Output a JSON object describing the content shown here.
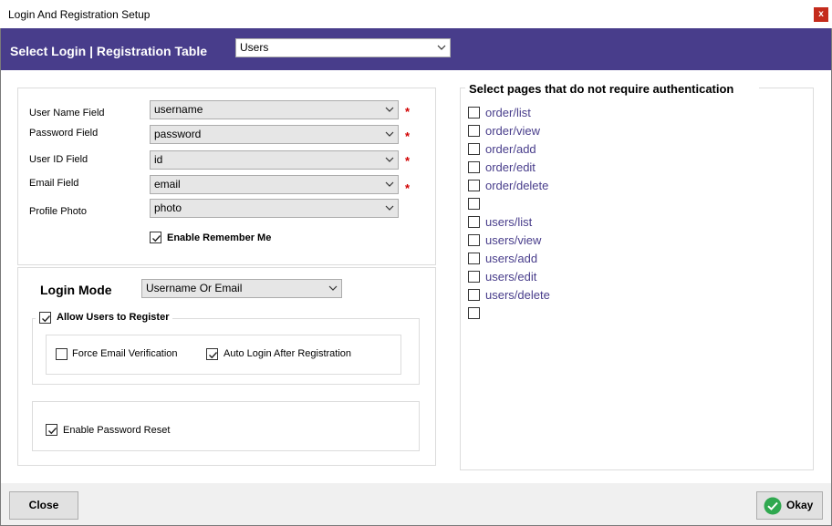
{
  "window": {
    "title": "Login And Registration Setup",
    "close_glyph": "x"
  },
  "header": {
    "title": "Select Login | Registration Table",
    "table_value": "Users"
  },
  "fields": [
    {
      "label": "User Name Field",
      "value": "username",
      "required": "*"
    },
    {
      "label": "Password Field",
      "value": "password",
      "required": "*"
    },
    {
      "label": "User ID Field",
      "value": "id",
      "required": "*"
    },
    {
      "label": "Email Field",
      "value": "email",
      "required": "*"
    },
    {
      "label": "Profile Photo",
      "value": "photo",
      "required": ""
    }
  ],
  "remember_me": {
    "label": "Enable Remember Me",
    "checked": true
  },
  "login_mode": {
    "label": "Login Mode",
    "value": "Username Or Email"
  },
  "registration": {
    "allow_label": "Allow Users to Register",
    "allow_checked": true,
    "force_email_label": "Force Email Verification",
    "force_email_checked": false,
    "auto_login_label": "Auto Login After Registration",
    "auto_login_checked": true
  },
  "password_reset": {
    "label": "Enable Password Reset",
    "checked": true
  },
  "pages": {
    "title": "Select pages that do not require authentication",
    "items": [
      "order/list",
      "order/view",
      "order/add",
      "order/edit",
      "order/delete",
      "",
      "users/list",
      "users/view",
      "users/add",
      "users/edit",
      "users/delete",
      ""
    ]
  },
  "footer": {
    "close_label": "Close",
    "okay_label": "Okay"
  },
  "colors": {
    "header_bg": "#483d8b",
    "link": "#483d8b",
    "required": "#d10000",
    "okay_icon": "#2fa84f"
  }
}
